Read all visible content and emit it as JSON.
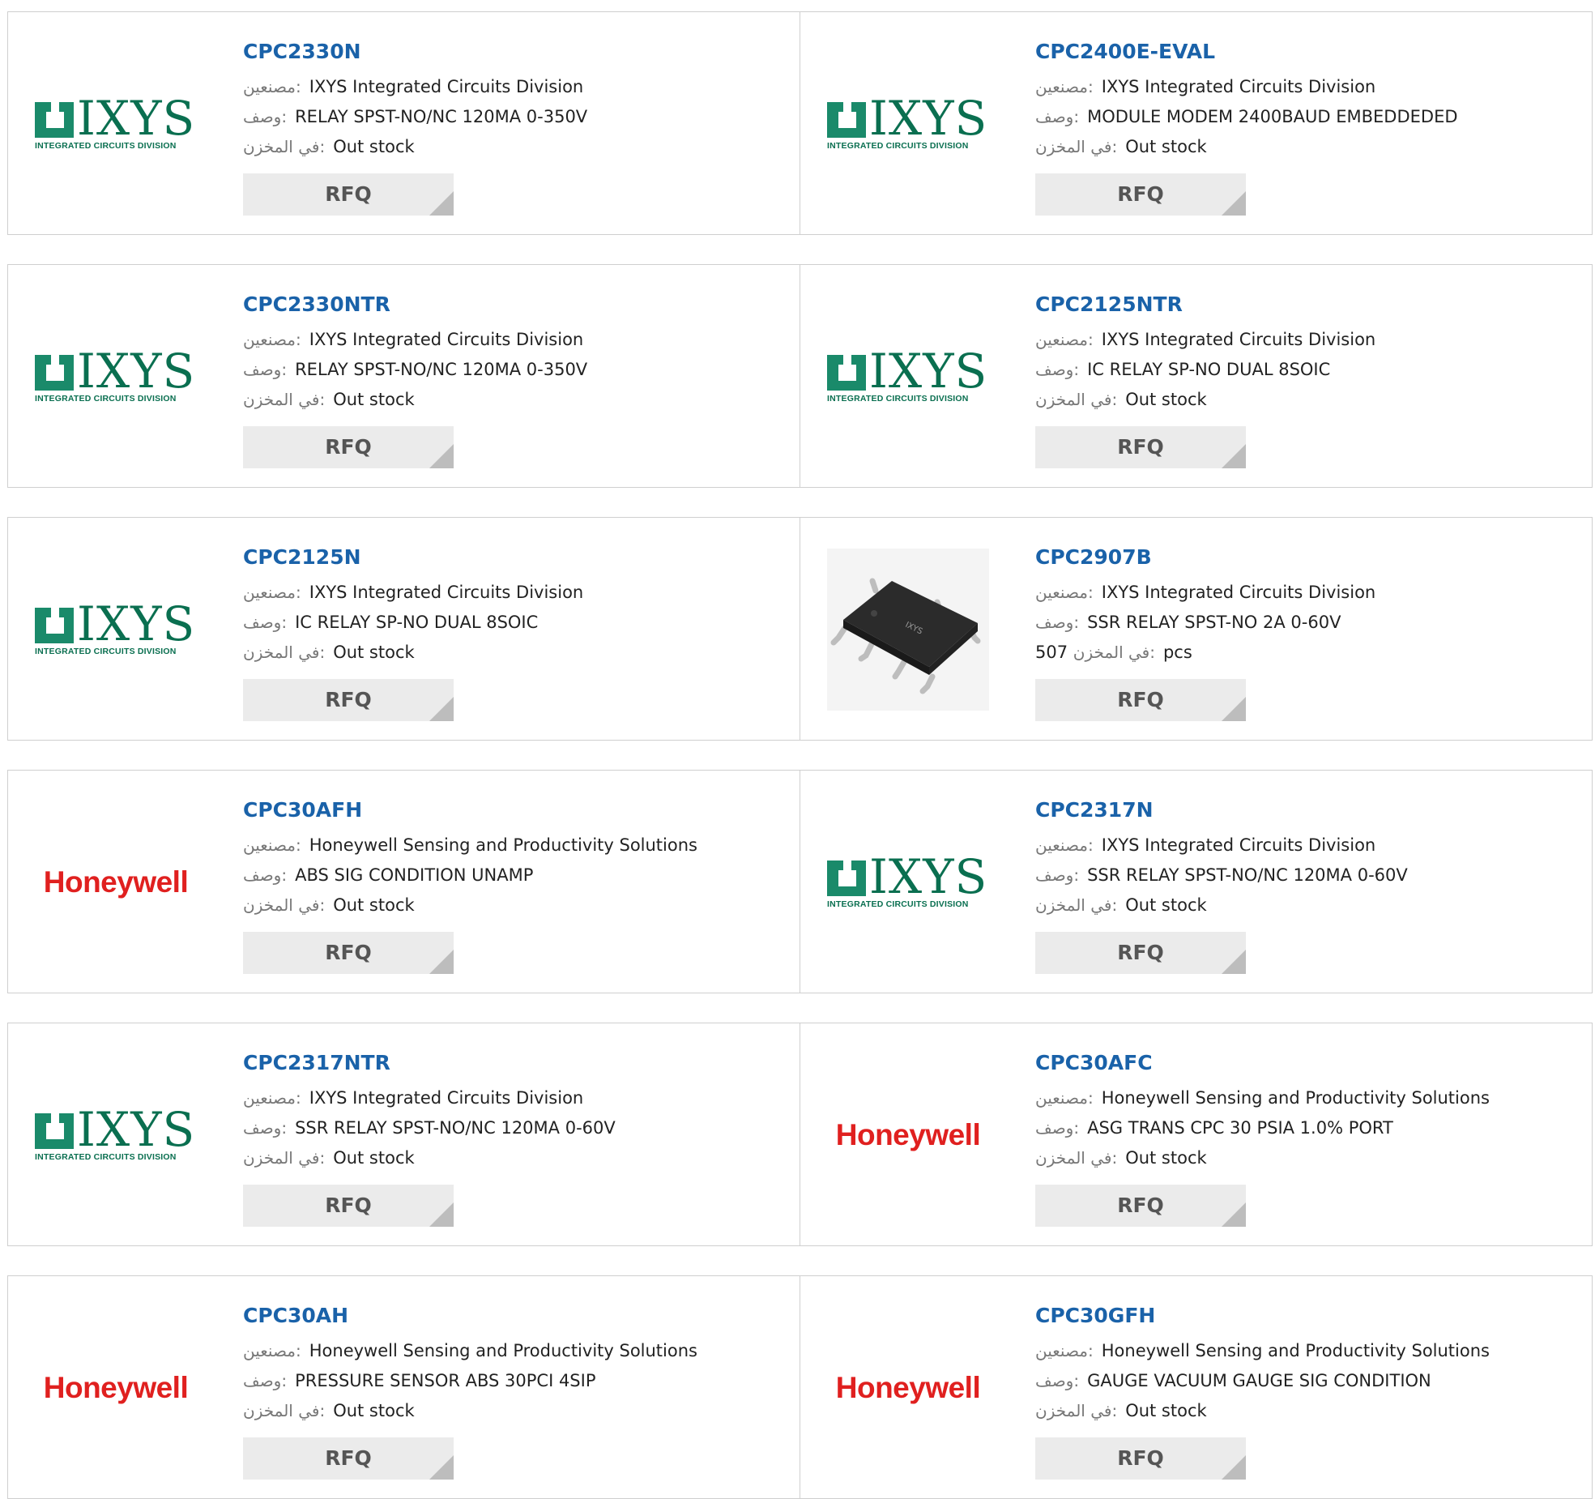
{
  "labels": {
    "manufacturer": "مصنعين:",
    "description": "وصف:",
    "stock": "في المخزن:",
    "rfq": "RFQ",
    "pcs": "pcs"
  },
  "products": [
    {
      "part": "CPC2330N",
      "logo": "ixys",
      "manufacturer": "IXYS Integrated Circuits Division",
      "description": "RELAY SPST-NO/NC 120MA 0-350V",
      "stock": "Out stock"
    },
    {
      "part": "CPC2400E-EVAL",
      "logo": "ixys",
      "manufacturer": "IXYS Integrated Circuits Division",
      "description": "MODULE MODEM 2400BAUD EMBEDDEDED",
      "stock": "Out stock"
    },
    {
      "part": "CPC2330NTR",
      "logo": "ixys",
      "manufacturer": "IXYS Integrated Circuits Division",
      "description": "RELAY SPST-NO/NC 120MA 0-350V",
      "stock": "Out stock"
    },
    {
      "part": "CPC2125NTR",
      "logo": "ixys",
      "manufacturer": "IXYS Integrated Circuits Division",
      "description": "IC RELAY SP-NO DUAL 8SOIC",
      "stock": "Out stock"
    },
    {
      "part": "CPC2125N",
      "logo": "ixys",
      "manufacturer": "IXYS Integrated Circuits Division",
      "description": "IC RELAY SP-NO DUAL 8SOIC",
      "stock": "Out stock"
    },
    {
      "part": "CPC2907B",
      "logo": "chip",
      "manufacturer": "IXYS Integrated Circuits Division",
      "description": "SSR RELAY SPST-NO 2A 0-60V",
      "stock": "507",
      "in_stock": true
    },
    {
      "part": "CPC30AFH",
      "logo": "honeywell",
      "manufacturer": "Honeywell Sensing and Productivity Solutions",
      "description": "ABS SIG CONDITION UNAMP",
      "stock": "Out stock"
    },
    {
      "part": "CPC2317N",
      "logo": "ixys",
      "manufacturer": "IXYS Integrated Circuits Division",
      "description": "SSR RELAY SPST-NO/NC 120MA 0-60V",
      "stock": "Out stock"
    },
    {
      "part": "CPC2317NTR",
      "logo": "ixys",
      "manufacturer": "IXYS Integrated Circuits Division",
      "description": "SSR RELAY SPST-NO/NC 120MA 0-60V",
      "stock": "Out stock"
    },
    {
      "part": "CPC30AFC",
      "logo": "honeywell",
      "manufacturer": "Honeywell Sensing and Productivity Solutions",
      "description": "ASG TRANS CPC 30 PSIA 1.0% PORT",
      "stock": "Out stock"
    },
    {
      "part": "CPC30AH",
      "logo": "honeywell",
      "manufacturer": "Honeywell Sensing and Productivity Solutions",
      "description": "PRESSURE SENSOR ABS 30PCI 4SIP",
      "stock": "Out stock"
    },
    {
      "part": "CPC30GFH",
      "logo": "honeywell",
      "manufacturer": "Honeywell Sensing and Productivity Solutions",
      "description": "GAUGE VACUUM GAUGE SIG CONDITION",
      "stock": "Out stock"
    }
  ],
  "logo_text": {
    "ixys_wordmark": "IXYS",
    "ixys_sub": "INTEGRATED CIRCUITS DIVISION",
    "honeywell": "Honeywell"
  },
  "colors": {
    "link": "#1a62a9",
    "ixys_green": "#0a6f50",
    "honeywell_red": "#e0201f",
    "rfq_bg": "#ebebeb"
  }
}
